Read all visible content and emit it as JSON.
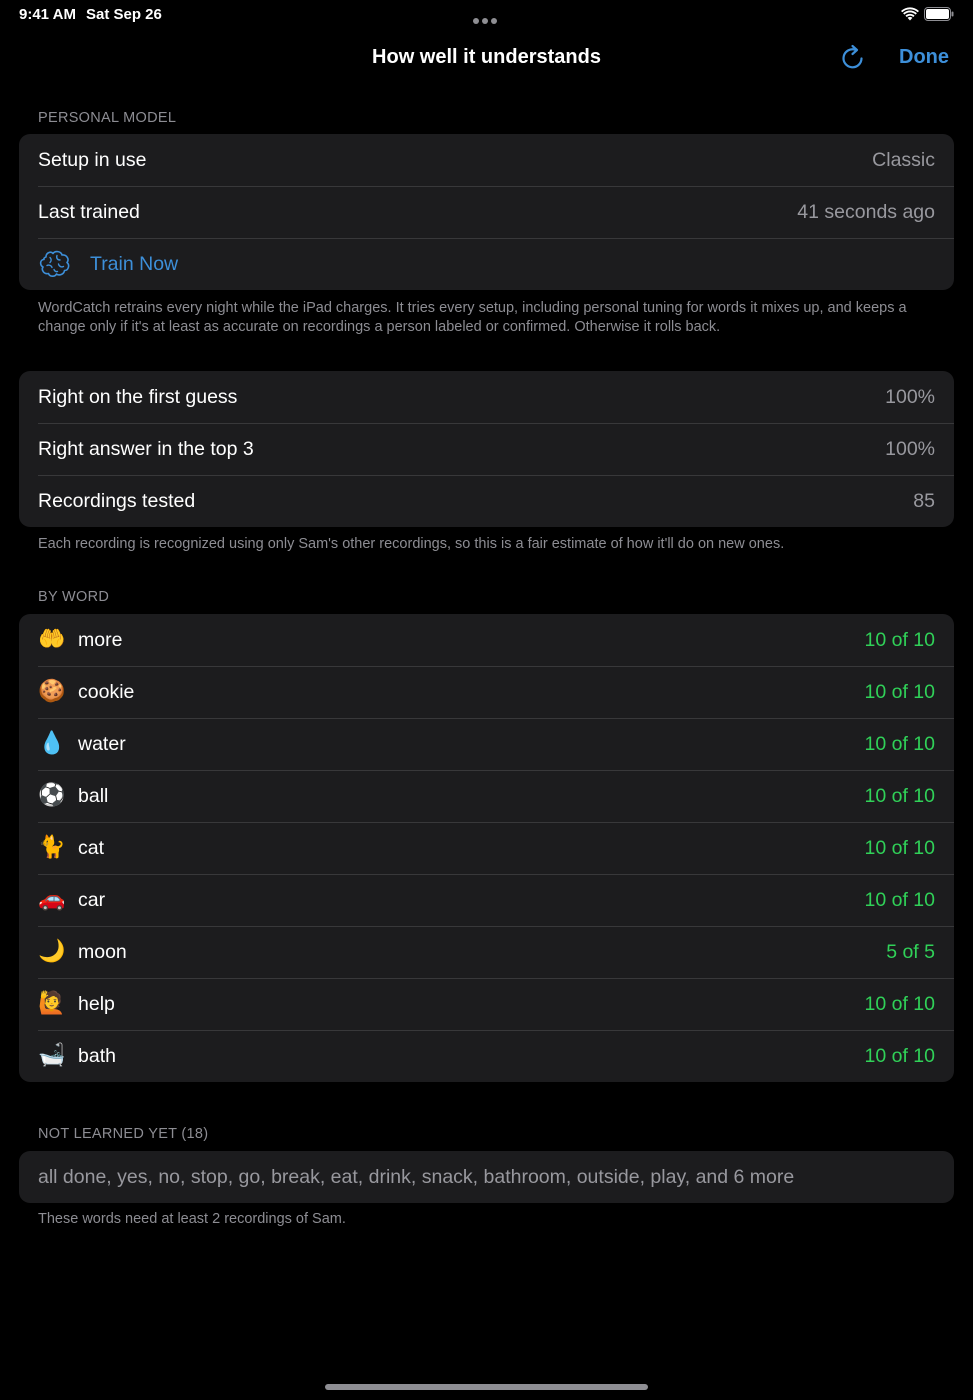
{
  "status": {
    "time": "9:41 AM",
    "date": "Sat Sep 26"
  },
  "nav": {
    "title": "How well it understands",
    "done_label": "Done",
    "refresh_icon": "arrow-clockwise-icon"
  },
  "personal_model": {
    "header": "PERSONAL MODEL",
    "rows": [
      {
        "label": "Setup in use",
        "value": "Classic"
      },
      {
        "label": "Last trained",
        "value": "41 seconds ago"
      }
    ],
    "train_label": "Train Now",
    "train_icon": "brain-icon",
    "footer": "WordCatch retrains every night while the iPad charges. It tries every setup, including personal tuning for words it mixes up, and keeps a change only if it's at least as accurate on recordings a person labeled or confirmed. Otherwise it rolls back."
  },
  "accuracy": {
    "rows": [
      {
        "label": "Right on the first guess",
        "value": "100%"
      },
      {
        "label": "Right answer in the top 3",
        "value": "100%"
      },
      {
        "label": "Recordings tested",
        "value": "85"
      }
    ],
    "footer": "Each recording is recognized using only Sam's other recordings, so this is a fair estimate of how it'll do on new ones."
  },
  "by_word": {
    "header": "BY WORD",
    "accent_color": "#30d158",
    "words": [
      {
        "emoji": "🤲",
        "label": "more",
        "value": "10 of 10"
      },
      {
        "emoji": "🍪",
        "label": "cookie",
        "value": "10 of 10"
      },
      {
        "emoji": "💧",
        "label": "water",
        "value": "10 of 10"
      },
      {
        "emoji": "⚽",
        "label": "ball",
        "value": "10 of 10"
      },
      {
        "emoji": "🐈",
        "label": "cat",
        "value": "10 of 10"
      },
      {
        "emoji": "🚗",
        "label": "car",
        "value": "10 of 10"
      },
      {
        "emoji": "🌙",
        "label": "moon",
        "value": "5 of 5"
      },
      {
        "emoji": "🙋",
        "label": "help",
        "value": "10 of 10"
      },
      {
        "emoji": "🛁",
        "label": "bath",
        "value": "10 of 10"
      }
    ]
  },
  "not_learned": {
    "header": "NOT LEARNED YET (18)",
    "list": "all done, yes, no, stop, go, break, eat, drink, snack, bathroom, outside, play, and 6 more",
    "footer": "These words need at least 2 recordings of Sam."
  },
  "colors": {
    "background": "#000000",
    "card": "#1c1c1e",
    "accent_blue": "#3d8fd9",
    "secondary_text": "#98989e"
  }
}
